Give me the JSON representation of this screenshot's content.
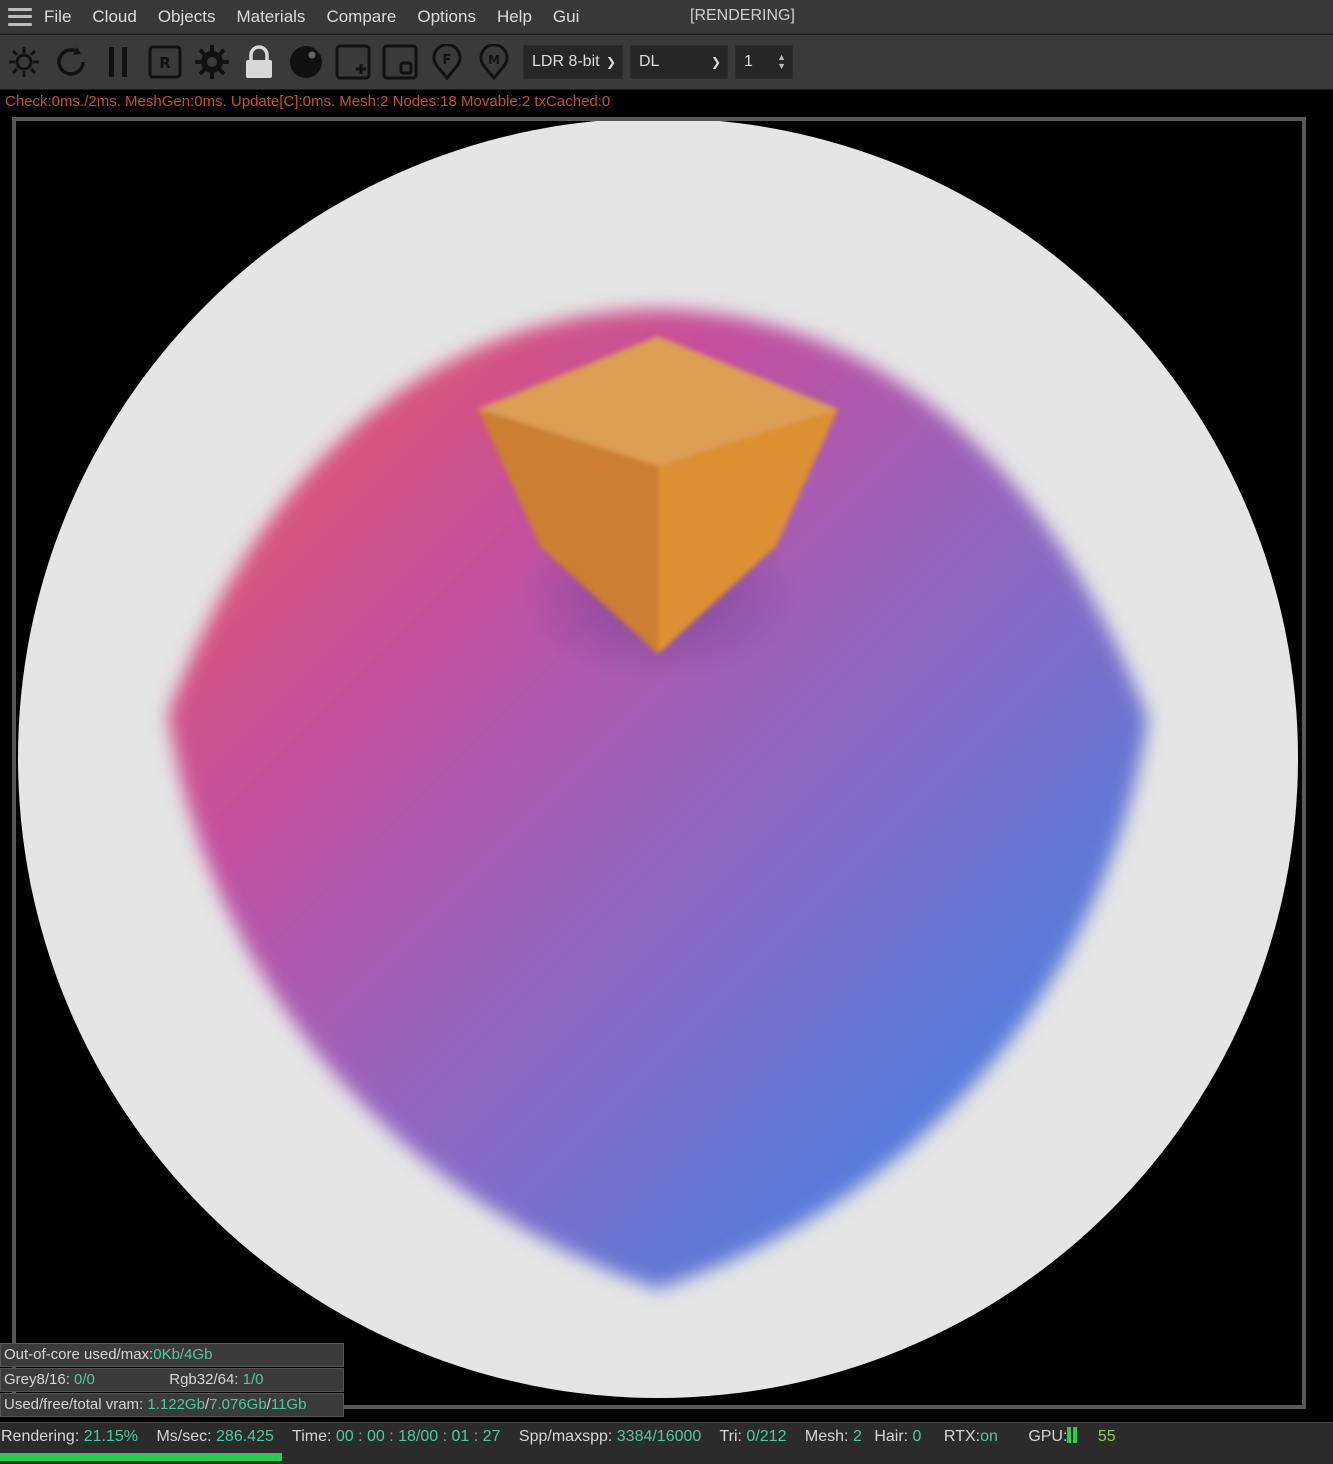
{
  "menu": {
    "items": [
      "File",
      "Cloud",
      "Objects",
      "Materials",
      "Compare",
      "Options",
      "Help",
      "Gui"
    ],
    "status": "[RENDERING]"
  },
  "toolbar": {
    "icons": [
      "renderer-settings-icon",
      "restart-icon",
      "pause-icon",
      "region-render-icon",
      "settings-gear-icon",
      "lock-icon",
      "material-sphere-icon",
      "add-region-icon",
      "film-region-icon",
      "focus-picker-icon",
      "material-picker-icon"
    ],
    "format_select": "LDR 8-bit",
    "kernel_select": "DL",
    "spinner_value": "1"
  },
  "info_line": "Check:0ms./2ms. MeshGen:0ms. Update[C]:0ms. Mesh:2 Nodes:18 Movable:2 txCached:0",
  "overlay": {
    "out_of_core_label": "Out-of-core used/max:",
    "out_of_core_value": "0Kb/4Gb",
    "grey_label": "Grey8/16:",
    "grey_value": "0/0",
    "rgb_label": "Rgb32/64:",
    "rgb_value": "1/0",
    "vram_label": "Used/free/total vram:",
    "vram_used": "1.122Gb",
    "vram_free": "7.076Gb",
    "vram_total": "11Gb"
  },
  "status": {
    "rendering_label": "Rendering:",
    "rendering_value": "21.15%",
    "progress_fraction": 0.2115,
    "mssec_label": "Ms/sec:",
    "mssec_value": "286.425",
    "time_label": "Time:",
    "time_value": "00 : 00 : 18/00 : 01 : 27",
    "spp_label": "Spp/maxspp:",
    "spp_value": "3384/16000",
    "tri_label": "Tri:",
    "tri_value": "0/212",
    "mesh_label": "Mesh:",
    "mesh_value": "2",
    "hair_label": "Hair:",
    "hair_value": "0",
    "rtx_label": "RTX:",
    "rtx_value": "on",
    "gpu_label": "GPU:",
    "gpu_value": "55"
  },
  "colors": {
    "accent_green": "#27d04a",
    "value_teal": "#4ecb9a",
    "info_orange": "#c4561c",
    "cube_orange": "#dc9a3e",
    "blob_red": "#e95c5c",
    "blob_purple": "#9a5fb6",
    "blob_blue": "#3484e8"
  }
}
